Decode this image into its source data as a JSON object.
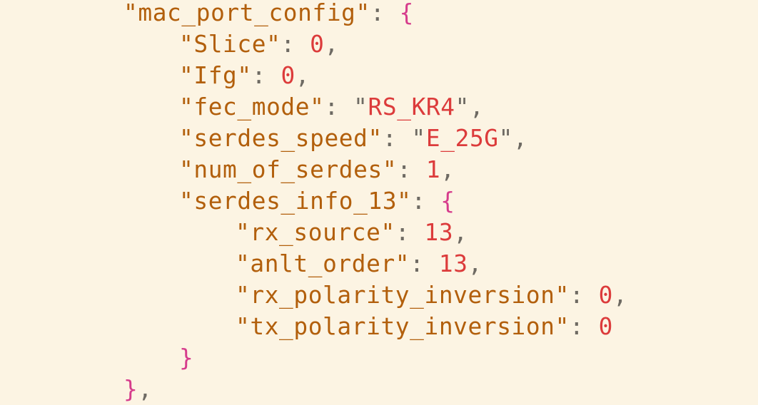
{
  "theme": {
    "background": "#fcf4e3",
    "key": "#b25f0c",
    "punctuation": "#6e6a63",
    "brace": "#d63c8c",
    "number": "#dc3b3b",
    "string": "#dc3b3b"
  },
  "lines": [
    [
      {
        "t": "key",
        "v": "\"mac_port_config\""
      },
      {
        "t": "punctuation",
        "v": ": "
      },
      {
        "t": "brace",
        "v": "{"
      }
    ],
    [
      {
        "t": "key",
        "v": "\"Slice\""
      },
      {
        "t": "punctuation",
        "v": ": "
      },
      {
        "t": "number",
        "v": "0"
      },
      {
        "t": "punctuation",
        "v": ","
      }
    ],
    [
      {
        "t": "key",
        "v": "\"Ifg\""
      },
      {
        "t": "punctuation",
        "v": ": "
      },
      {
        "t": "number",
        "v": "0"
      },
      {
        "t": "punctuation",
        "v": ","
      }
    ],
    [
      {
        "t": "key",
        "v": "\"fec_mode\""
      },
      {
        "t": "punctuation",
        "v": ": "
      },
      {
        "t": "punctuation",
        "v": "\""
      },
      {
        "t": "string",
        "v": "RS_KR4"
      },
      {
        "t": "punctuation",
        "v": "\","
      }
    ],
    [
      {
        "t": "key",
        "v": "\"serdes_speed\""
      },
      {
        "t": "punctuation",
        "v": ": "
      },
      {
        "t": "punctuation",
        "v": "\""
      },
      {
        "t": "string",
        "v": "E_25G"
      },
      {
        "t": "punctuation",
        "v": "\","
      }
    ],
    [
      {
        "t": "key",
        "v": "\"num_of_serdes\""
      },
      {
        "t": "punctuation",
        "v": ": "
      },
      {
        "t": "number",
        "v": "1"
      },
      {
        "t": "punctuation",
        "v": ","
      }
    ],
    [
      {
        "t": "key",
        "v": "\"serdes_info_13\""
      },
      {
        "t": "punctuation",
        "v": ": "
      },
      {
        "t": "brace",
        "v": "{"
      }
    ],
    [
      {
        "t": "key",
        "v": "\"rx_source\""
      },
      {
        "t": "punctuation",
        "v": ": "
      },
      {
        "t": "number",
        "v": "13"
      },
      {
        "t": "punctuation",
        "v": ","
      }
    ],
    [
      {
        "t": "key",
        "v": "\"anlt_order\""
      },
      {
        "t": "punctuation",
        "v": ": "
      },
      {
        "t": "number",
        "v": "13"
      },
      {
        "t": "punctuation",
        "v": ","
      }
    ],
    [
      {
        "t": "key",
        "v": "\"rx_polarity_inversion\""
      },
      {
        "t": "punctuation",
        "v": ": "
      },
      {
        "t": "number",
        "v": "0"
      },
      {
        "t": "punctuation",
        "v": ","
      }
    ],
    [
      {
        "t": "key",
        "v": "\"tx_polarity_inversion\""
      },
      {
        "t": "punctuation",
        "v": ": "
      },
      {
        "t": "number",
        "v": "0"
      }
    ],
    [
      {
        "t": "brace",
        "v": "}"
      }
    ],
    [
      {
        "t": "brace",
        "v": "}"
      },
      {
        "t": "punctuation",
        "v": ","
      }
    ]
  ]
}
